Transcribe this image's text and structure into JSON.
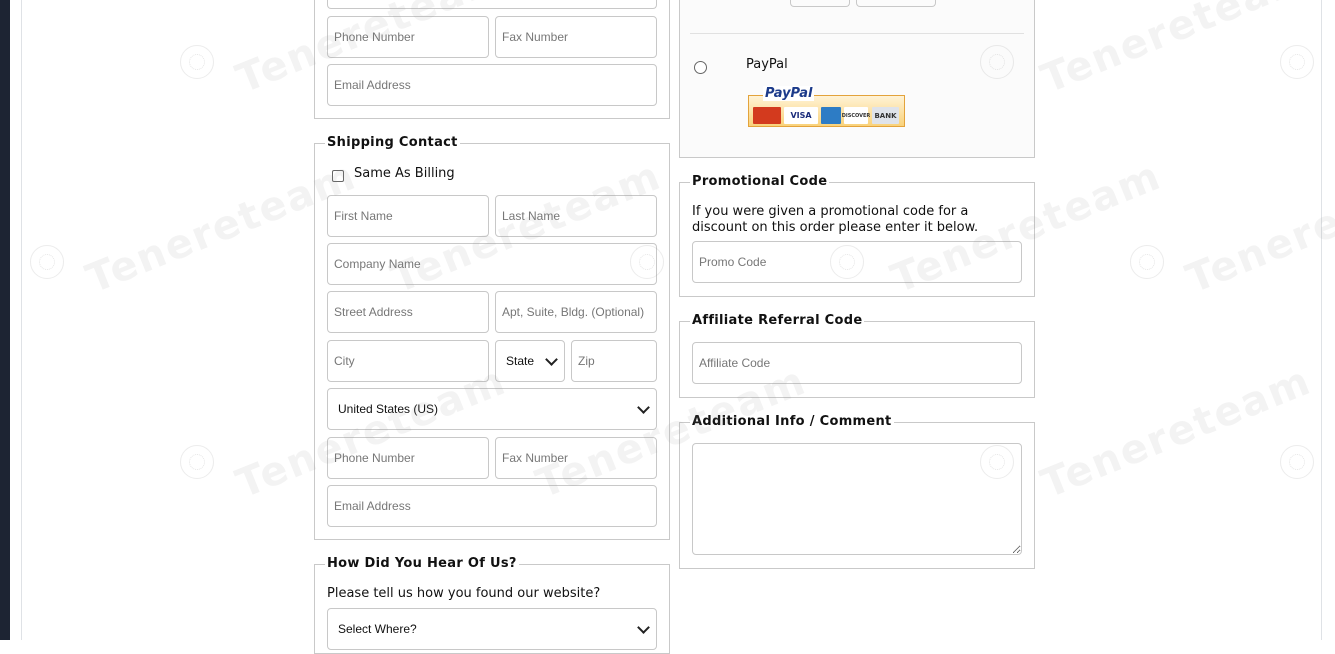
{
  "billing": {
    "phone_placeholder": "Phone Number",
    "fax_placeholder": "Fax Number",
    "email_placeholder": "Email Address"
  },
  "shipping": {
    "legend": "Shipping Contact",
    "same_as_billing_label": "Same As Billing",
    "first_name_placeholder": "First Name",
    "last_name_placeholder": "Last Name",
    "company_placeholder": "Company Name",
    "street_placeholder": "Street Address",
    "apt_placeholder": "Apt, Suite, Bldg. (Optional)",
    "city_placeholder": "City",
    "state_selected": "State",
    "zip_placeholder": "Zip",
    "country_selected": "United States (US)",
    "phone_placeholder": "Phone Number",
    "fax_placeholder": "Fax Number",
    "email_placeholder": "Email Address"
  },
  "hear": {
    "legend": "How Did You Hear Of Us?",
    "prompt": "Please tell us how you found our website?",
    "selected": "Select Where?"
  },
  "payment": {
    "paypal_label": "PayPal",
    "paypal_logo_text": "PayPal",
    "cards": [
      "MasterCard",
      "VISA",
      "AMEX",
      "DISCOVER",
      "BANK"
    ]
  },
  "promo": {
    "legend": "Promotional Code",
    "description": "If you were given a promotional code for a discount on this order please enter it below.",
    "placeholder": "Promo Code"
  },
  "affiliate": {
    "legend": "Affiliate Referral Code",
    "placeholder": "Affiliate Code"
  },
  "additional": {
    "legend": "Additional Info / Comment"
  },
  "watermark": {
    "text": "Tenereteam",
    "color": "#969696"
  }
}
